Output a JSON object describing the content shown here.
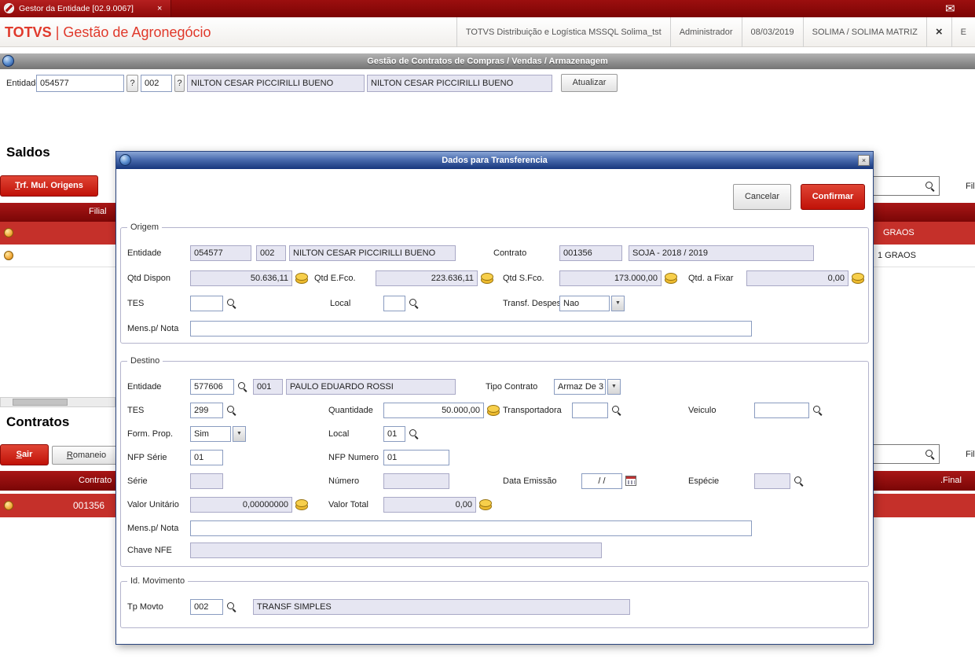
{
  "icons": {
    "dropdown": "▼",
    "mail": "✉",
    "close": "×"
  },
  "topbar": {
    "tab_title": "Gestor da Entidade [02.9.0067]"
  },
  "header": {
    "brand_totvs": "TOTVS",
    "brand_app": "| Gestão de Agronegócio",
    "environment": "TOTVS Distribuição e Logística MSSQL Solima_tst",
    "user": "Administrador",
    "date": "08/03/2019",
    "company": "SOLIMA / SOLIMA MATRIZ",
    "partial": "E"
  },
  "panel": {
    "title": "Gestão de Contratos de Compras / Vendas / Armazenagem"
  },
  "entity_bar": {
    "label": "Entidade",
    "code": "054577",
    "help": "?",
    "store": "002",
    "name": "NILTON CESAR PICCIRILLI BUENO",
    "name2": "NILTON CESAR PICCIRILLI BUENO",
    "update": "Atualizar"
  },
  "saldos": {
    "title": "Saldos",
    "trf_button": "Trf. Mul. Origens",
    "col_filial": "Filial",
    "row1": "GRAOS",
    "row2": "1 GRAOS",
    "filter": "Fil"
  },
  "contratos": {
    "title": "Contratos",
    "sair_button": "Sair",
    "romaneio_button": "Romaneio",
    "col_contrato": "Contrato",
    "col_final": ".Final",
    "row1": "001356",
    "filter": "Fil"
  },
  "modal": {
    "title": "Dados para Transferencia",
    "cancel": "Cancelar",
    "confirm": "Confirmar",
    "origem": {
      "legend": "Origem",
      "entidade_label": "Entidade",
      "entidade": "054577",
      "loja": "002",
      "nome": "NILTON CESAR PICCIRILLI BUENO",
      "contrato_label": "Contrato",
      "contrato": "001356",
      "contrato_desc": "SOJA  - 2018 / 2019",
      "qtd_dispon_label": "Qtd Dispon",
      "qtd_dispon": "50.636,11",
      "qtd_efco_label": "Qtd E.Fco.",
      "qtd_efco": "223.636,11",
      "qtd_sfco_label": "Qtd S.Fco.",
      "qtd_sfco": "173.000,00",
      "qtd_fixar_label": "Qtd. a Fixar",
      "qtd_fixar": "0,00",
      "tes_label": "TES",
      "local_label": "Local",
      "transf_despesa_label": "Transf. Despesa",
      "transf_despesa": "Nao",
      "mens_label": "Mens.p/ Nota"
    },
    "destino": {
      "legend": "Destino",
      "entidade_label": "Entidade",
      "entidade": "577606",
      "loja": "001",
      "nome": "PAULO EDUARDO ROSSI",
      "tipo_contrato_label": "Tipo Contrato",
      "tipo_contrato": "Armaz De 3",
      "tes_label": "TES",
      "tes": "299",
      "quantidade_label": "Quantidade",
      "quantidade": "50.000,00",
      "transportadora_label": "Transportadora",
      "veiculo_label": "Veiculo",
      "form_prop_label": "Form. Prop.",
      "form_prop": "Sim",
      "local_label": "Local",
      "local": "01",
      "nfp_serie_label": "NFP Série",
      "nfp_serie": "01",
      "nfp_numero_label": "NFP Numero",
      "nfp_numero": "01",
      "serie_label": "Série",
      "numero_label": "Número",
      "data_emissao_label": "Data Emissão",
      "data_emissao": "/  /",
      "especie_label": "Espécie",
      "valor_unitario_label": "Valor Unitário",
      "valor_unitario": "0,00000000",
      "valor_total_label": "Valor Total",
      "valor_total": "0,00",
      "mens_label": "Mens.p/ Nota",
      "chave_label": "Chave NFE"
    },
    "movimento": {
      "legend": "Id. Movimento",
      "tp_movto_label": "Tp Movto",
      "tp_movto": "002",
      "tp_movto_desc": "TRANSF SIMPLES"
    }
  }
}
